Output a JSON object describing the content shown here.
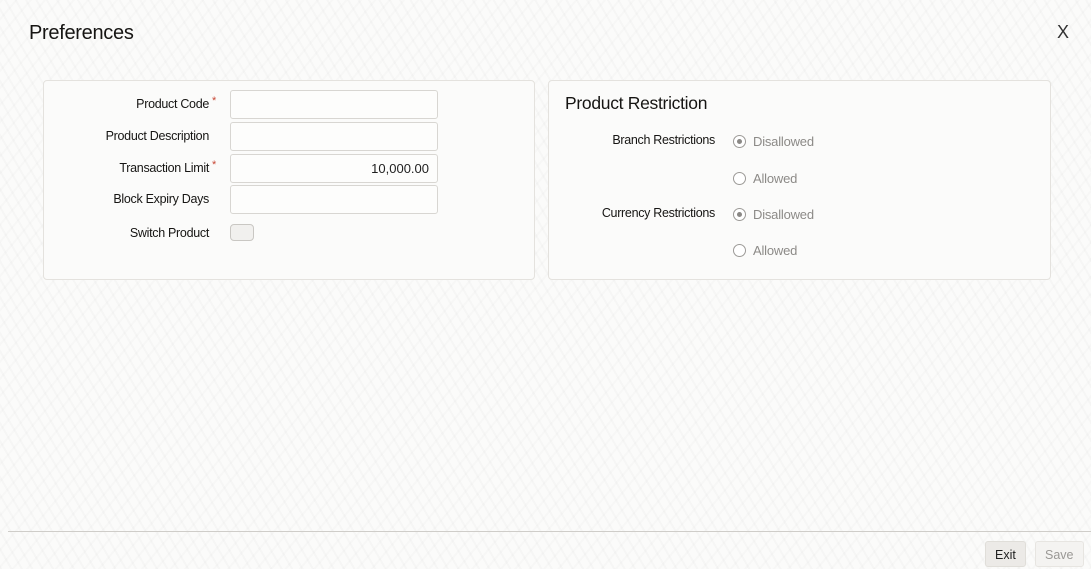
{
  "header": {
    "title": "Preferences",
    "close_label": "X"
  },
  "preferences": {
    "product_code": {
      "label": "Product Code",
      "required_mark": "*",
      "value": ""
    },
    "product_description": {
      "label": "Product Description",
      "value": ""
    },
    "transaction_limit": {
      "label": "Transaction Limit",
      "required_mark": "*",
      "value": "10,000.00"
    },
    "block_expiry_days": {
      "label": "Block Expiry Days",
      "value": ""
    },
    "switch_product": {
      "label": "Switch Product",
      "checked": false
    }
  },
  "product_restriction": {
    "title": "Product Restriction",
    "branch": {
      "label": "Branch Restrictions",
      "options": [
        "Disallowed",
        "Allowed"
      ],
      "selected": "Disallowed"
    },
    "currency": {
      "label": "Currency Restrictions",
      "options": [
        "Disallowed",
        "Allowed"
      ],
      "selected": "Disallowed"
    }
  },
  "footer": {
    "exit_label": "Exit",
    "save_label": "Save"
  },
  "colors": {
    "required": "#c74634",
    "background": "#fbfbfa",
    "panel_border": "#e4e2de"
  }
}
